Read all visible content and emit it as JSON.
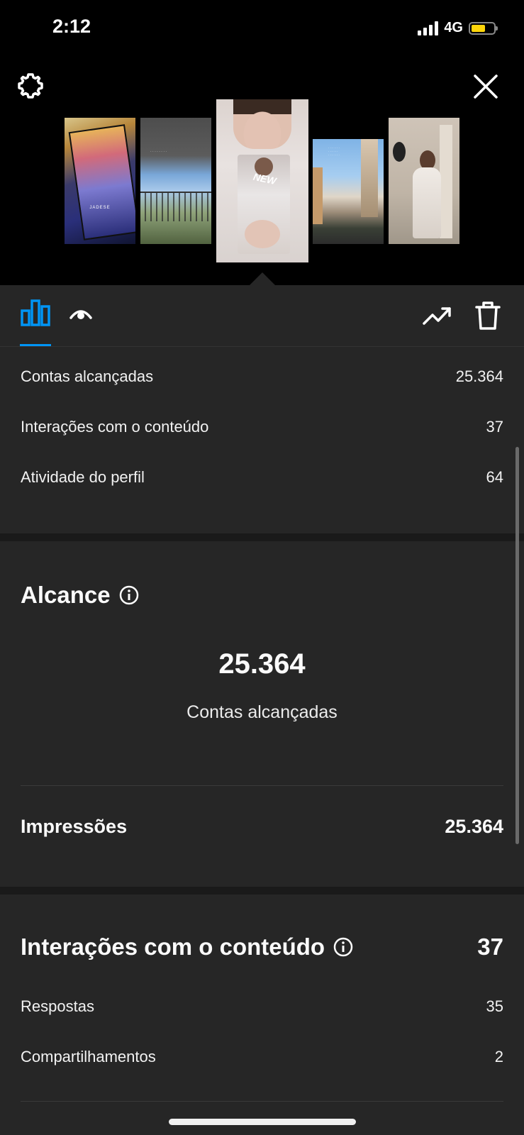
{
  "status_bar": {
    "time": "2:12",
    "network": "4G",
    "battery_level": 0.62
  },
  "header": {
    "settings_icon": "gear-icon",
    "close_icon": "close-icon"
  },
  "story_thumbnails": {
    "thumb1_text": "JADESE",
    "thumb3_text": "NEW"
  },
  "tabs": {
    "insights_icon": "bar-chart-icon",
    "viewers_icon": "eye-icon",
    "promote_icon": "trending-up-icon",
    "delete_icon": "trash-icon",
    "active_color": "#0095f6"
  },
  "overview": [
    {
      "label": "Contas alcançadas",
      "value": "25.364"
    },
    {
      "label": "Interações com o conteúdo",
      "value": "37"
    },
    {
      "label": "Atividade do perfil",
      "value": "64"
    }
  ],
  "reach": {
    "title": "Alcance",
    "big_value": "25.364",
    "big_label": "Contas alcançadas",
    "impressions_label": "Impressões",
    "impressions_value": "25.364"
  },
  "interactions": {
    "title": "Interações com o conteúdo",
    "total": "37",
    "rows": [
      {
        "label": "Respostas",
        "value": "35"
      },
      {
        "label": "Compartilhamentos",
        "value": "2"
      }
    ]
  }
}
